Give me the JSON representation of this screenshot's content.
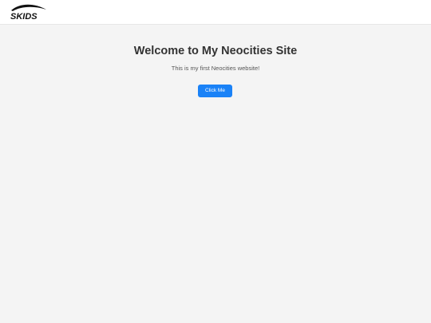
{
  "header": {
    "logo_text": "SKIDS"
  },
  "main": {
    "title": "Welcome to My Neocities Site",
    "subtitle": "This is my first Neocities website!",
    "button_label": "Click Me"
  },
  "colors": {
    "background": "#f4f4f4",
    "header_bg": "#ffffff",
    "button_bg": "#1a82f7",
    "title_text": "#333333"
  }
}
